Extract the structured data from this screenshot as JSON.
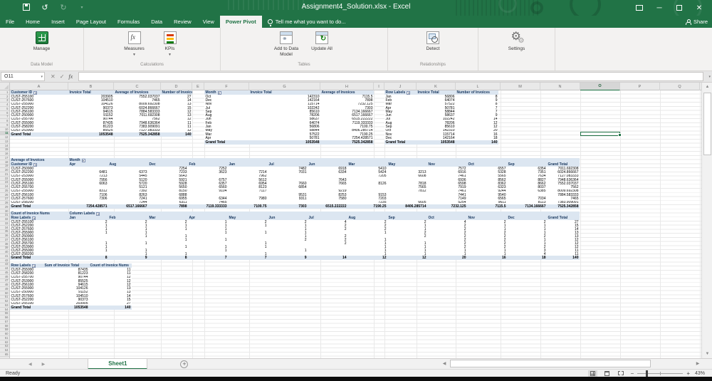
{
  "titlebar": {
    "title": "Assignment4_Solution.xlsx - Excel"
  },
  "tabs": [
    "File",
    "Home",
    "Insert",
    "Page Layout",
    "Formulas",
    "Data",
    "Review",
    "View",
    "Power Pivot"
  ],
  "active_tab": "Power Pivot",
  "tell_me": "Tell me what you want to do...",
  "share_label": "Share",
  "ribbon": {
    "groups": [
      {
        "label": "Data Model",
        "buttons": [
          {
            "label": "Manage",
            "icon": "data-model-icon",
            "dropdown": false
          }
        ]
      },
      {
        "label": "Calculations",
        "buttons": [
          {
            "label": "Measures",
            "icon": "measures-icon",
            "dropdown": true
          },
          {
            "label": "KPIs",
            "icon": "kpi-icon",
            "dropdown": true
          }
        ]
      },
      {
        "label": "Tables",
        "buttons": [
          {
            "label": "Add to Data Model",
            "icon": "add-to-data-model-icon",
            "dropdown": false
          },
          {
            "label": "Update All",
            "icon": "update-all-icon",
            "dropdown": false
          }
        ]
      },
      {
        "label": "Relationships",
        "buttons": [
          {
            "label": "Detect",
            "icon": "detect-icon",
            "dropdown": false
          }
        ]
      },
      {
        "label": "",
        "buttons": [
          {
            "label": "Settings",
            "icon": "settings-icon",
            "dropdown": false
          }
        ]
      }
    ]
  },
  "formula_bar": {
    "name_box": "O11",
    "formula": ""
  },
  "sheet": {
    "columns": [
      "A",
      "B",
      "C",
      "D",
      "E",
      "F",
      "G",
      "H",
      "I",
      "J",
      "K",
      "L",
      "M",
      "N",
      "O",
      "P",
      "Q"
    ],
    "selected_column": "O",
    "selected_row": 11,
    "row_count": 65,
    "tab_name": "Sheet1",
    "status": "Ready",
    "zoom": "43%"
  },
  "colors": {
    "accent": "#217346",
    "pivot_band": "#dce6f1"
  },
  "tables": {
    "t1": {
      "headers": [
        "Customer ID",
        "Invoice Total",
        "Average of Invoices",
        "Number of Invoices"
      ],
      "rows": [
        [
          "CUST-255100",
          203905,
          7552.037037,
          27
        ],
        [
          "CUST-257600",
          104510,
          7465,
          14
        ],
        [
          "CUST-255900",
          104126,
          8009.692308,
          13
        ],
        [
          "CUST-252200",
          90373,
          6024.866667,
          15
        ],
        [
          "CUST-256100",
          94615,
          7884.583333,
          12
        ],
        [
          "CUST-250900",
          91152,
          7011.692308,
          13
        ],
        [
          "CUST-255700",
          90744,
          7562,
          12
        ],
        [
          "CUST-255000",
          87435,
          7948.636364,
          11
        ],
        [
          "CUST-258200",
          81223,
          7383.909091,
          11
        ],
        [
          "CUST-253900",
          85525,
          7127.083333,
          12
        ]
      ],
      "total": [
        "Grand Total",
        1053548,
        7525.342858,
        140
      ]
    },
    "t2": {
      "headers": [
        "Month",
        "Invoice Total",
        "Average of Invoices"
      ],
      "rows": [
        [
          "Oct",
          142310,
          7115.5
        ],
        [
          "Dec",
          142164,
          7898
        ],
        [
          "Nov",
          115714,
          7232.125
        ],
        [
          "Jul",
          102242,
          7303
        ],
        [
          "Sep",
          85610,
          7134.166667
        ],
        [
          "Aug",
          78206,
          6517.166667
        ],
        [
          "Jun",
          58637,
          6515.222222
        ],
        [
          "Feb",
          64074,
          7119.333333
        ],
        [
          "Jan",
          56806,
          7100.75
        ],
        [
          "May",
          58844,
          8406.285714
        ],
        [
          "Mar",
          57522,
          7190.25
        ],
        [
          "Apr",
          50781,
          7254.428571
        ]
      ],
      "total": [
        "Grand Total",
        1053548,
        7525.342858
      ]
    },
    "t3": {
      "headers": [
        "Row Labels",
        "Invoice Total",
        "Number of Invoices"
      ],
      "rows": [
        [
          "Jan",
          56806,
          8
        ],
        [
          "Feb",
          64074,
          9
        ],
        [
          "Mar",
          57522,
          8
        ],
        [
          "Apr",
          50781,
          7
        ],
        [
          "May",
          58844,
          7
        ],
        [
          "Jun",
          58637,
          9
        ],
        [
          "Jul",
          102242,
          14
        ],
        [
          "Aug",
          78206,
          12
        ],
        [
          "Sep",
          85610,
          12
        ],
        [
          "Oct",
          142310,
          20
        ],
        [
          "Nov",
          115714,
          16
        ],
        [
          "Dec",
          142164,
          18
        ]
      ],
      "total": [
        "Grand Total",
        1053548,
        140
      ]
    },
    "tm": {
      "title": "Average of Invoices",
      "col_title": "Month",
      "row_title": "Customer ID",
      "months": [
        "Apr",
        "Aug",
        "Dec",
        "Feb",
        "Jan",
        "Jul",
        "Jun",
        "Mar",
        "May",
        "Nov",
        "Oct",
        "Sep"
      ],
      "gt_label": "Grand Total",
      "total_label": "Grand Total",
      "rows": [
        {
          "id": "CUST-250900",
          "cells": [
            null,
            null,
            7254,
            7252,
            null,
            7482,
            6918,
            5410,
            null,
            7572,
            6557,
            6354
          ],
          "total": 7011.692308
        },
        {
          "id": "CUST-252200",
          "cells": [
            6481,
            6373,
            7233,
            3623,
            7214,
            7031,
            6334,
            5424,
            3213,
            6916,
            5328,
            7351
          ],
          "total": 6024.866667
        },
        {
          "id": "CUST-253900",
          "cells": [
            7213,
            5445,
            5643,
            null,
            7962,
            null,
            null,
            7205,
            6608,
            7461,
            5565,
            7634
          ],
          "total": 7127.083333
        },
        {
          "id": "CUST-255000",
          "cells": [
            7956,
            5120,
            5921,
            6757,
            5612,
            null,
            7643,
            null,
            null,
            6936,
            8562,
            8827
          ],
          "total": 7948.636364
        },
        {
          "id": "CUST-255100",
          "cells": [
            6063,
            5720,
            5928,
            6357,
            6954,
            7660,
            7665,
            8126,
            7818,
            6598,
            8362,
            8662
          ],
          "total": 7552.037037
        },
        {
          "id": "CUST-255700",
          "cells": [
            null,
            5121,
            5650,
            6560,
            8123,
            6854,
            null,
            null,
            7565,
            7919,
            6323,
            8037
          ],
          "total": 7562
        },
        {
          "id": "CUST-255900",
          "cells": [
            8312,
            7392,
            8150,
            9104,
            7117,
            null,
            9219,
            null,
            7812,
            7461,
            9244,
            6385
          ],
          "total": 8009.692308
        },
        {
          "id": "CUST-256100",
          "cells": [
            7106,
            8263,
            6888,
            null,
            null,
            9531,
            8253,
            9153,
            null,
            7441,
            9540,
            null
          ],
          "total": 7884.583333
        },
        {
          "id": "CUST-257600",
          "cells": [
            7306,
            7241,
            6955,
            6344,
            7980,
            9311,
            7580,
            7203,
            null,
            7149,
            6565,
            7034
          ],
          "total": 7465
        },
        {
          "id": "CUST-258200",
          "cells": [
            null,
            7244,
            6311,
            7465,
            null,
            null,
            null,
            7235,
            6605,
            5254,
            9611,
            8113
          ],
          "total": 7383.909091
        }
      ],
      "total_row": {
        "cells": [
          7254.428571,
          6517.166667,
          7898,
          7119.333333,
          7100.75,
          7303,
          6515.222222,
          7190.25,
          8406.285714,
          7232.125,
          7115.5,
          7134.166667
        ],
        "total": 7525.342858
      }
    },
    "t4": {
      "title": "Count of Invoice Nums",
      "col_title": "Column Labels",
      "row_title": "Row Labels",
      "months": [
        "Jan",
        "Feb",
        "Mar",
        "Apr",
        "May",
        "Jun",
        "Jul",
        "Aug",
        "Sep",
        "Oct",
        "Nov",
        "Dec"
      ],
      "gt_label": "Grand Total",
      "total_label": "Grand Total",
      "rows": [
        {
          "id": "CUST-255100",
          "cells": [
            2,
            2,
            2,
            1,
            2,
            2,
            4,
            2,
            2,
            4,
            2,
            2
          ],
          "total": 27
        },
        {
          "id": "CUST-252200",
          "cells": [
            1,
            1,
            1,
            1,
            1,
            1,
            2,
            2,
            1,
            2,
            1,
            1
          ],
          "total": 15
        },
        {
          "id": "CUST-257600",
          "cells": [
            1,
            1,
            1,
            1,
            null,
            1,
            2,
            2,
            1,
            2,
            1,
            1
          ],
          "total": 14
        },
        {
          "id": "CUST-255900",
          "cells": [
            1,
            1,
            null,
            1,
            1,
            1,
            null,
            1,
            2,
            2,
            2,
            1
          ],
          "total": 13
        },
        {
          "id": "CUST-250900",
          "cells": [
            null,
            1,
            1,
            null,
            null,
            1,
            2,
            null,
            2,
            2,
            2,
            2
          ],
          "total": 13
        },
        {
          "id": "CUST-256100",
          "cells": [
            null,
            null,
            1,
            1,
            null,
            2,
            2,
            1,
            null,
            2,
            2,
            1
          ],
          "total": 12
        },
        {
          "id": "CUST-255700",
          "cells": [
            1,
            1,
            null,
            null,
            1,
            null,
            2,
            1,
            1,
            2,
            2,
            1
          ],
          "total": 12
        },
        {
          "id": "CUST-253900",
          "cells": [
            1,
            null,
            1,
            1,
            1,
            null,
            null,
            1,
            1,
            2,
            2,
            2
          ],
          "total": 12
        },
        {
          "id": "CUST-255000",
          "cells": [
            1,
            1,
            null,
            1,
            null,
            1,
            null,
            1,
            1,
            1,
            1,
            3
          ],
          "total": 11
        },
        {
          "id": "CUST-258200",
          "cells": [
            null,
            1,
            1,
            null,
            1,
            null,
            null,
            1,
            1,
            1,
            1,
            4
          ],
          "total": 11
        }
      ],
      "total_row": {
        "cells": [
          8,
          9,
          8,
          7,
          7,
          9,
          14,
          12,
          12,
          20,
          16,
          18
        ],
        "total": 140
      }
    },
    "t5": {
      "headers": [
        "Row Labels",
        "Sum of Invoice Total",
        "Count of Invoice Nums"
      ],
      "rows": [
        [
          "CUST-255000",
          87435,
          11
        ],
        [
          "CUST-258200",
          81223,
          11
        ],
        [
          "CUST-255700",
          90744,
          12
        ],
        [
          "CUST-253900",
          85525,
          12
        ],
        [
          "CUST-256100",
          94615,
          12
        ],
        [
          "CUST-255900",
          104126,
          13
        ],
        [
          "CUST-250900",
          91152,
          13
        ],
        [
          "CUST-257600",
          104510,
          14
        ],
        [
          "CUST-252200",
          90373,
          15
        ],
        [
          "CUST-255100",
          203905,
          27
        ]
      ],
      "total": [
        "Grand Total",
        1053548,
        140
      ]
    }
  }
}
